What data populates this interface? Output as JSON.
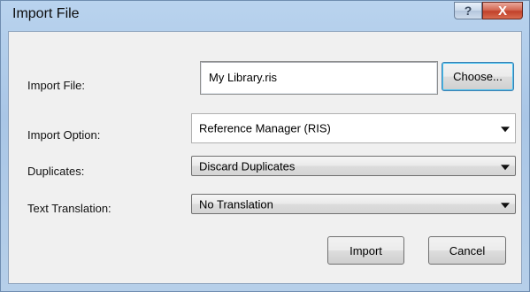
{
  "window": {
    "title": "Import File",
    "help_label": "?",
    "close_label": "X"
  },
  "form": {
    "import_file_label": "Import File:",
    "import_file_value": "My Library.ris",
    "choose_label": "Choose...",
    "import_option_label": "Import Option:",
    "import_option_value": "Reference Manager (RIS)",
    "duplicates_label": "Duplicates:",
    "duplicates_value": "Discard Duplicates",
    "text_translation_label": "Text Translation:",
    "text_translation_value": "No Translation"
  },
  "buttons": {
    "import_label": "Import",
    "cancel_label": "Cancel"
  },
  "icons": {
    "dropdown": "chevron-down-icon"
  }
}
